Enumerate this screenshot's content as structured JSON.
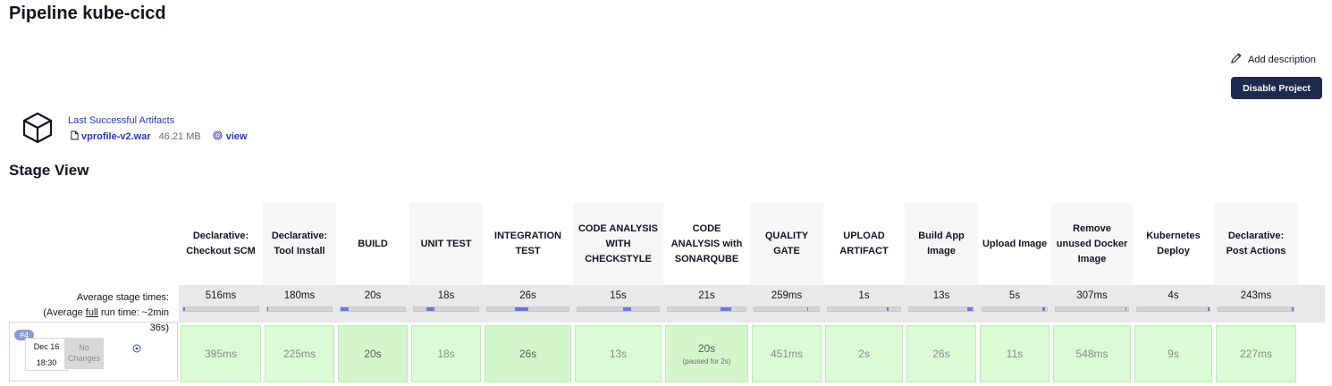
{
  "header": {
    "title": "Pipeline kube-cicd",
    "add_description": "Add description",
    "disable_button": "Disable Project"
  },
  "artifacts": {
    "title": "Last Successful Artifacts",
    "file": "vprofile-v2.war",
    "size": "46.21 MB",
    "view": "view"
  },
  "stage_view": {
    "title": "Stage View",
    "avg_label_line1": "Average stage times:",
    "avg_label_prefix": "(Average ",
    "avg_label_full": "full",
    "avg_label_suffix": " run time: ~2min",
    "avg_label_line3": "36s)",
    "stages": [
      {
        "name": "Declarative: Checkout SCM",
        "avg": "516ms",
        "avg_fraction": 0.02,
        "run": "395ms",
        "note": ""
      },
      {
        "name": "Declarative: Tool Install",
        "avg": "180ms",
        "avg_fraction": 0.01,
        "run": "225ms",
        "note": ""
      },
      {
        "name": "BUILD",
        "avg": "20s",
        "avg_fraction": 0.13,
        "run": "20s",
        "note": ""
      },
      {
        "name": "UNIT TEST",
        "avg": "18s",
        "avg_fraction": 0.12,
        "run": "18s",
        "note": ""
      },
      {
        "name": "INTEGRATION TEST",
        "avg": "26s",
        "avg_fraction": 0.17,
        "run": "26s",
        "note": ""
      },
      {
        "name": "CODE ANALYSIS WITH CHECKSTYLE",
        "avg": "15s",
        "avg_fraction": 0.1,
        "run": "13s",
        "note": ""
      },
      {
        "name": "CODE ANALYSIS with SONARQUBE",
        "avg": "21s",
        "avg_fraction": 0.14,
        "run": "20s",
        "note": "(paused for 2s)"
      },
      {
        "name": "QUALITY GATE",
        "avg": "259ms",
        "avg_fraction": 0.02,
        "run": "451ms",
        "note": ""
      },
      {
        "name": "UPLOAD ARTIFACT",
        "avg": "1s",
        "avg_fraction": 0.02,
        "run": "2s",
        "note": ""
      },
      {
        "name": "Build App Image",
        "avg": "13s",
        "avg_fraction": 0.09,
        "run": "26s",
        "note": ""
      },
      {
        "name": "Upload Image",
        "avg": "5s",
        "avg_fraction": 0.04,
        "run": "11s",
        "note": ""
      },
      {
        "name": "Remove unused Docker Image",
        "avg": "307ms",
        "avg_fraction": 0.02,
        "run": "548ms",
        "note": ""
      },
      {
        "name": "Kubernetes Deploy",
        "avg": "4s",
        "avg_fraction": 0.03,
        "run": "9s",
        "note": ""
      },
      {
        "name": "Declarative: Post Actions",
        "avg": "243ms",
        "avg_fraction": 0.02,
        "run": "227ms",
        "note": ""
      }
    ]
  },
  "build": {
    "number": "#4",
    "date": "Dec 16",
    "time": "18:30",
    "changes": "No Changes"
  },
  "colors": {
    "accent": "#2a34c8",
    "button_bg": "#1d2a4d",
    "success_cell": "#dafbd4",
    "bar_fill": "#6a78d8"
  }
}
